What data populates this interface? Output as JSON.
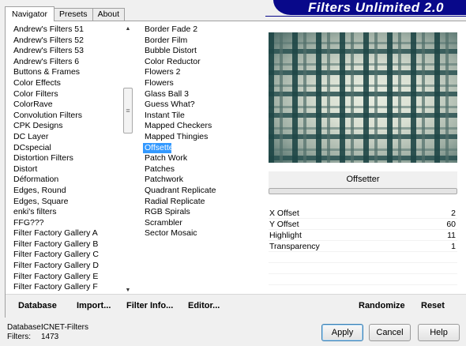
{
  "header": {
    "title": "Filters Unlimited 2.0",
    "tabs": [
      {
        "label": "Navigator",
        "active": true
      },
      {
        "label": "Presets",
        "active": false
      },
      {
        "label": "About",
        "active": false
      }
    ]
  },
  "categories": [
    "Andrew's Filters 51",
    "Andrew's Filters 52",
    "Andrew's Filters 53",
    "Andrew's Filters 6",
    "Buttons & Frames",
    "Color Effects",
    "Color Filters",
    "ColorRave",
    "Convolution Filters",
    "CPK Designs",
    "DC Layer",
    "DCspecial",
    "Distortion Filters",
    "Distort",
    "Déformation",
    "Edges, Round",
    "Edges, Square",
    "enki's filters",
    "FFG???",
    "Filter Factory Gallery A",
    "Filter Factory Gallery B",
    "Filter Factory Gallery C",
    "Filter Factory Gallery D",
    "Filter Factory Gallery E",
    "Filter Factory Gallery F"
  ],
  "filters": [
    "Border Fade 2",
    "Border Film",
    "Bubble Distort",
    "Color Reductor",
    "Flowers 2",
    "Flowers",
    "Glass Ball 3",
    "Guess What?",
    "Instant Tile",
    "Mapped Checkers",
    "Mapped Thingies",
    "Offsetter",
    "Patch Work",
    "Patches",
    "Patchwork",
    "Quadrant Replicate",
    "Radial Replicate",
    "RGB Spirals",
    "Scrambler",
    "Sector Mosaic"
  ],
  "selected_filter": "Offsetter",
  "parameters": [
    {
      "name": "X Offset",
      "value": "2"
    },
    {
      "name": "Y Offset",
      "value": "60"
    },
    {
      "name": "Highlight",
      "value": "11"
    },
    {
      "name": "Transparency",
      "value": "1"
    }
  ],
  "bar": {
    "database": "Database",
    "import": "Import...",
    "filter_info": "Filter Info...",
    "editor": "Editor...",
    "randomize": "Randomize",
    "reset": "Reset"
  },
  "footer": {
    "database_label": "Database:",
    "database_value": "ICNET-Filters",
    "filters_label": "Filters:",
    "filters_value": "1473",
    "apply": "Apply",
    "cancel": "Cancel",
    "help": "Help"
  },
  "colors": {
    "banner": "#08088a",
    "selection": "#3399ff"
  },
  "icons": {
    "scroll_up": "triangle-up",
    "scroll_down": "triangle-down",
    "thumb_grip": "grip-lines"
  }
}
